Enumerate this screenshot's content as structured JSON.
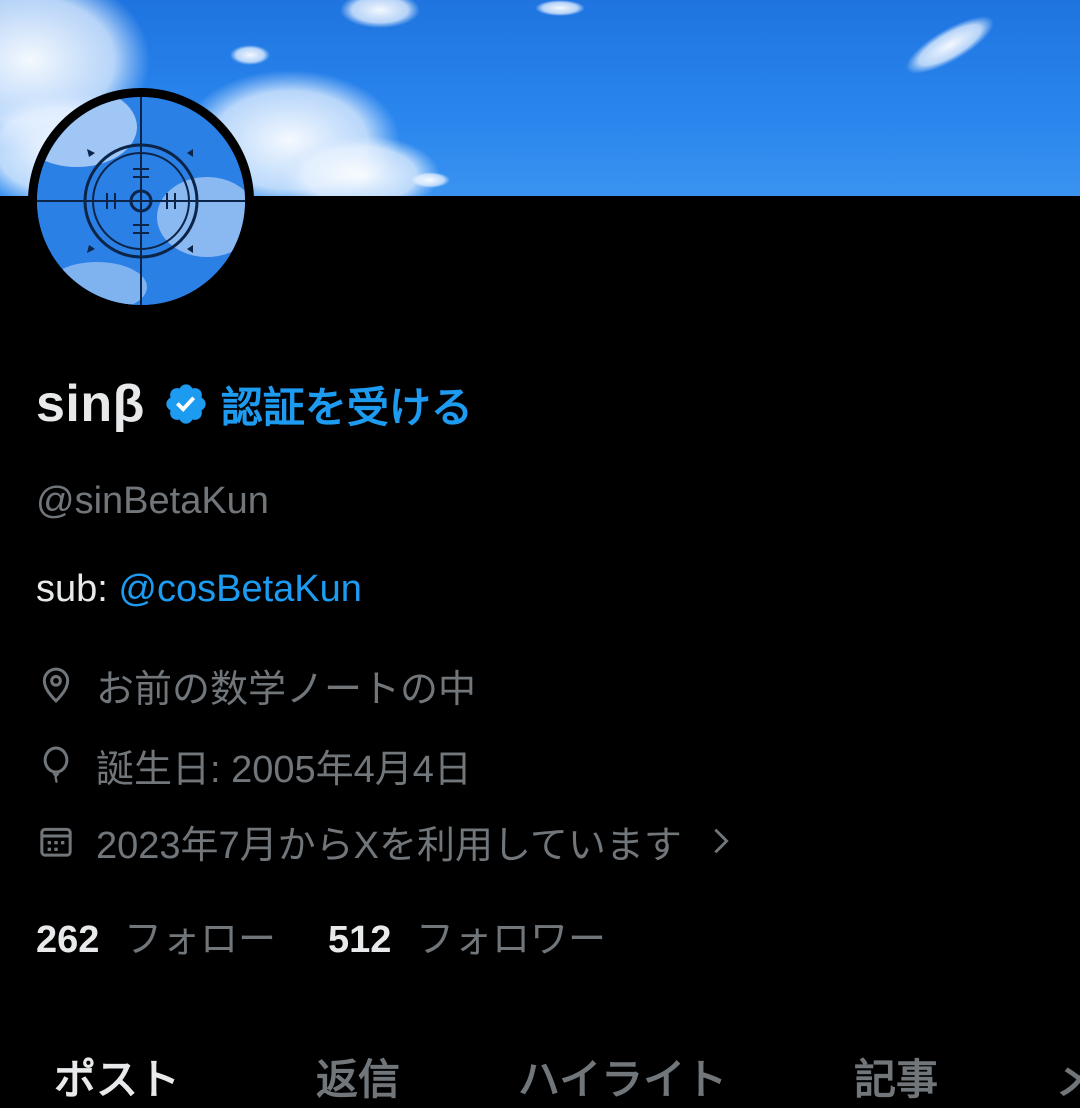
{
  "profile": {
    "display_name": "sinβ",
    "verify_link": "認証を受ける",
    "handle": "@sinBetaKun",
    "bio_prefix": "sub: ",
    "bio_mention": "@cosBetaKun",
    "location": "お前の数学ノートの中",
    "birthday": "誕生日: 2005年4月4日",
    "joined": "2023年7月からXを利用しています",
    "following_count": "262",
    "following_label": "フォロー",
    "followers_count": "512",
    "followers_label": "フォロワー"
  },
  "tabs": [
    {
      "label": "ポスト",
      "active": true
    },
    {
      "label": "返信",
      "active": false
    },
    {
      "label": "ハイライト",
      "active": false
    },
    {
      "label": "記事",
      "active": false
    },
    {
      "label": "メ",
      "active": false
    }
  ],
  "icons": {
    "verified": "verified-badge-icon",
    "location": "location-pin-icon",
    "birthday": "balloon-icon",
    "joined": "calendar-icon",
    "chevron": "chevron-right-icon"
  },
  "colors": {
    "accent": "#1d9bf0",
    "text_primary": "#e7e9ea",
    "text_secondary": "#71767b",
    "background": "#000000",
    "banner_sky": "#2a86ee"
  }
}
